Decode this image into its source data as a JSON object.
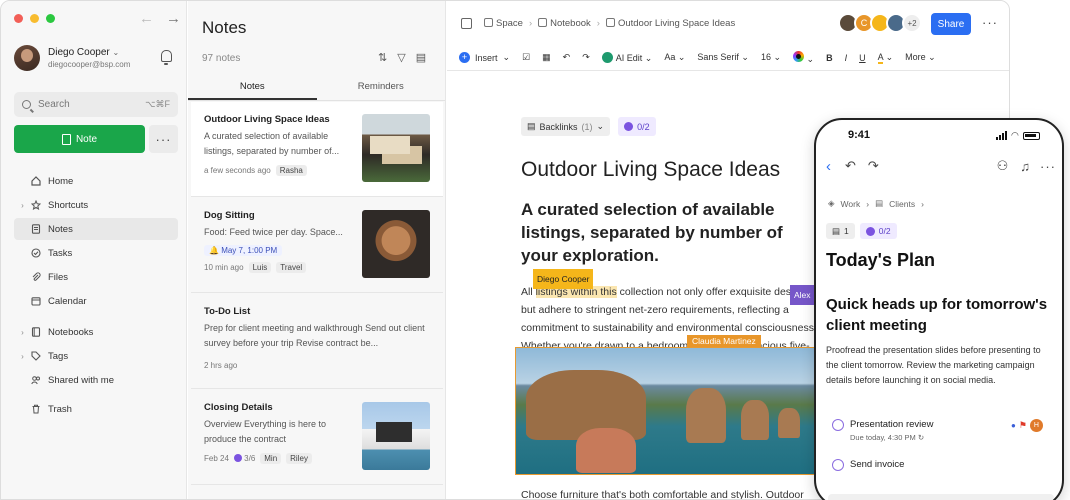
{
  "sidebar": {
    "user": {
      "name": "Diego Cooper",
      "email": "diegocooper@bsp.com"
    },
    "search": {
      "placeholder": "Search",
      "shortcut": "⌥⌘F"
    },
    "new_note_label": "Note",
    "nav": [
      {
        "label": "Home",
        "icon": "home-icon",
        "chevron": false,
        "active": false
      },
      {
        "label": "Shortcuts",
        "icon": "star-icon",
        "chevron": true,
        "active": false
      },
      {
        "label": "Notes",
        "icon": "note-icon",
        "chevron": false,
        "active": true
      },
      {
        "label": "Tasks",
        "icon": "check-circle-icon",
        "chevron": false,
        "active": false
      },
      {
        "label": "Files",
        "icon": "paperclip-icon",
        "chevron": false,
        "active": false
      },
      {
        "label": "Calendar",
        "icon": "calendar-icon",
        "chevron": false,
        "active": false
      },
      {
        "label": "Notebooks",
        "icon": "notebook-icon",
        "chevron": true,
        "active": false
      },
      {
        "label": "Tags",
        "icon": "tag-icon",
        "chevron": true,
        "active": false
      },
      {
        "label": "Shared with me",
        "icon": "people-icon",
        "chevron": false,
        "active": false
      },
      {
        "label": "Trash",
        "icon": "trash-icon",
        "chevron": false,
        "active": false
      }
    ]
  },
  "notelist": {
    "title": "Notes",
    "count": "97 notes",
    "tabs": [
      "Notes",
      "Reminders"
    ],
    "cards": [
      {
        "title": "Outdoor Living Space Ideas",
        "snippet": "A curated selection of available listings, separated by number of...",
        "time": "a few seconds ago",
        "tags": [
          "Rasha"
        ],
        "reminder": "",
        "thumb": "house"
      },
      {
        "title": "Dog Sitting",
        "snippet": "Food: Feed twice per day. Space...",
        "time": "10 min ago",
        "tags": [
          "Luis",
          "Travel"
        ],
        "reminder": "May 7, 1:00 PM",
        "thumb": "dog"
      },
      {
        "title": "To-Do List",
        "snippet": "Prep for client meeting and walkthrough Send out client survey before your trip Revise contract be...",
        "time": "2 hrs ago",
        "tags": [],
        "reminder": "",
        "thumb": ""
      },
      {
        "title": "Closing Details",
        "snippet": "Overview Everything is here to produce the contract",
        "time": "Feb 24",
        "progress": "3/6",
        "tags": [
          "Min",
          "Riley"
        ],
        "reminder": "",
        "thumb": "villa"
      }
    ]
  },
  "editor": {
    "breadcrumb": [
      "Space",
      "Notebook",
      "Outdoor Living Space Ideas"
    ],
    "collaborator_overflow": "+2",
    "share_label": "Share",
    "toolbar": {
      "insert": "Insert",
      "ai_edit": "AI Edit",
      "text_style": "Aa",
      "font": "Sans Serif",
      "size": "16",
      "bold": "B",
      "italic": "I",
      "underline": "U",
      "more": "More"
    },
    "backlinks": "Backlinks",
    "backlinks_count": "(1)",
    "tasks_progress": "0/2",
    "title": "Outdoor Living Space Ideas",
    "heading": "A curated selection of available listings, separated by number of your exploration.",
    "para_before": "All ",
    "para_highlight": "listings within this",
    "para_after": " collection not only offer exquisite design but adhere to stringent net-zero requirements, reflecting a commitment to sustainability and environmental consciousness. Whether you're drawn to a bedroom retreat or a spacious five-bedroom haven, these listings offer a harmonious fusion of luxury and eco-friendliness.",
    "cursor_diego": "Diego Cooper",
    "cursor_alex": "Alex",
    "cursor_claudia": "Claudia Martinez",
    "bottom_line": "Choose furniture that's both comfortable and stylish. Outdoor"
  },
  "phone": {
    "time": "9:41",
    "crumbs": [
      "Work",
      "Clients"
    ],
    "links_count": "1",
    "tasks_progress": "0/2",
    "title": "Today's Plan",
    "heading": "Quick heads up for tomorrow's client meeting",
    "paragraph": "Proofread the presentation slides before presenting to the client tomorrow. Review the marketing campaign details before launching it on social media.",
    "tasks": [
      {
        "label": "Presentation review",
        "due": "Due today, 4:30 PM"
      },
      {
        "label": "Send invoice",
        "due": ""
      }
    ],
    "assignee_initial": "H"
  },
  "colors": {
    "brand_green": "#1aa64a",
    "share_blue": "#2b6ef2",
    "highlight": "#fbe6b0",
    "diego": "#f5b61a",
    "alex": "#7656c9",
    "claudia": "#e8962a"
  }
}
